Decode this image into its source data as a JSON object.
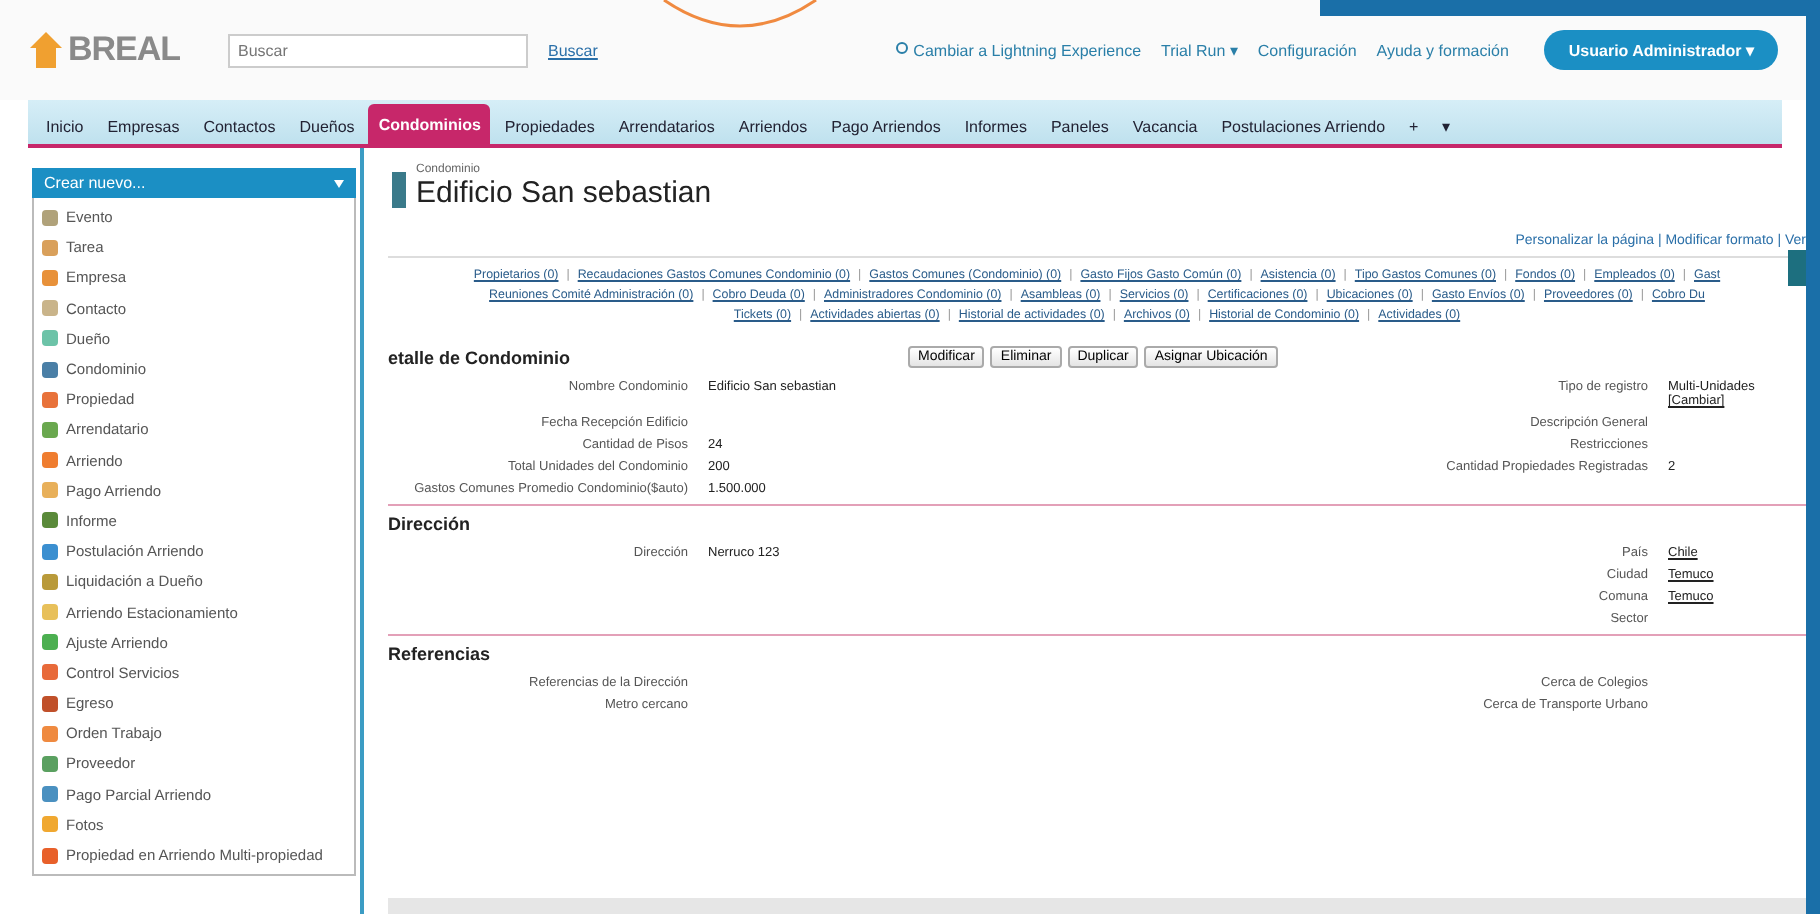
{
  "header": {
    "logo": "BREAL",
    "search": {
      "placeholder": "Buscar"
    },
    "search_button": "Buscar",
    "links": [
      {
        "label": "Cambiar a Lightning Experience",
        "kind": "lightning"
      },
      {
        "label": "Trial Run ▾",
        "kind": "plain"
      },
      {
        "label": "Configuración",
        "kind": "plain"
      },
      {
        "label": "Ayuda y formación",
        "kind": "plain"
      }
    ],
    "user_button": "Usuario Administrador ▾"
  },
  "tabs": [
    {
      "label": "Inicio",
      "selected": false
    },
    {
      "label": "Empresas",
      "selected": false
    },
    {
      "label": "Contactos",
      "selected": false
    },
    {
      "label": "Dueños",
      "selected": false
    },
    {
      "label": "Condominios",
      "selected": true
    },
    {
      "label": "Propiedades",
      "selected": false
    },
    {
      "label": "Arrendatarios",
      "selected": false
    },
    {
      "label": "Arriendos",
      "selected": false
    },
    {
      "label": "Pago Arriendos",
      "selected": false
    },
    {
      "label": "Informes",
      "selected": false
    },
    {
      "label": "Paneles",
      "selected": false
    },
    {
      "label": "Vacancia",
      "selected": false
    },
    {
      "label": "Postulaciones Arriendo",
      "selected": false
    },
    {
      "label": "+",
      "selected": false
    },
    {
      "label": "▾",
      "selected": false
    }
  ],
  "sidebar": {
    "create_button": "Crear nuevo...",
    "items": [
      {
        "label": "Evento",
        "color": "#b0a27a"
      },
      {
        "label": "Tarea",
        "color": "#d9a05b"
      },
      {
        "label": "Empresa",
        "color": "#e8913a"
      },
      {
        "label": "Contacto",
        "color": "#c9b48a"
      },
      {
        "label": "Dueño",
        "color": "#6cc3a8"
      },
      {
        "label": "Condominio",
        "color": "#4a7fa6"
      },
      {
        "label": "Propiedad",
        "color": "#e8723a"
      },
      {
        "label": "Arrendatario",
        "color": "#6aa84f"
      },
      {
        "label": "Arriendo",
        "color": "#ef7d30"
      },
      {
        "label": "Pago Arriendo",
        "color": "#e8b05a"
      },
      {
        "label": "Informe",
        "color": "#5a8a3a"
      },
      {
        "label": "Postulación Arriendo",
        "color": "#3b8fd0"
      },
      {
        "label": "Liquidación a Dueño",
        "color": "#b99a3a"
      },
      {
        "label": "Arriendo Estacionamiento",
        "color": "#e8c05a"
      },
      {
        "label": "Ajuste Arriendo",
        "color": "#4caf50"
      },
      {
        "label": "Control Servicios",
        "color": "#e86a3a"
      },
      {
        "label": "Egreso",
        "color": "#c0502a"
      },
      {
        "label": "Orden Trabajo",
        "color": "#ef8a40"
      },
      {
        "label": "Proveedor",
        "color": "#5aa060"
      },
      {
        "label": "Pago Parcial Arriendo",
        "color": "#4a90c0"
      },
      {
        "label": "Fotos",
        "color": "#f0a830"
      },
      {
        "label": "Propiedad en Arriendo Multi-propiedad",
        "color": "#e8602a"
      }
    ]
  },
  "record": {
    "type": "Condominio",
    "title": "Edificio San sebastian",
    "page_links": "Personalizar la página | Modificar formato | Ver",
    "related_separator": "|",
    "related_lists": [
      [
        "Propietarios (0)",
        "Recaudaciones Gastos Comunes Condominio (0)",
        "Gastos Comunes (Condominio) (0)",
        "Gasto Fijos Gasto Común (0)",
        "Asistencia (0)",
        "Tipo Gastos Comunes (0)",
        "Fondos (0)",
        "Empleados (0)",
        "Gast"
      ],
      [
        "Reuniones Comité Administración (0)",
        "Cobro Deuda (0)",
        "Administradores Condominio (0)",
        "Asambleas (0)",
        "Servicios (0)",
        "Certificaciones (0)",
        "Ubicaciones (0)",
        "Gasto Envíos (0)",
        "Proveedores (0)",
        "Cobro Du"
      ],
      [
        "Tickets (0)",
        "Actividades abiertas (0)",
        "Historial de actividades (0)",
        "Archivos (0)",
        "Historial de Condominio (0)",
        "Actividades (0)"
      ]
    ],
    "detail": {
      "title": "etalle de Condominio",
      "buttons": [
        "Modificar",
        "Eliminar",
        "Duplicar",
        "Asignar Ubicación"
      ],
      "rows": [
        {
          "left_label": "Nombre Condominio",
          "left_value": "Edificio San sebastian",
          "right_label": "Tipo de registro",
          "right_value": "Multi-Unidades",
          "right_link": "[Cambiar]"
        },
        {
          "left_label": "Fecha Recepción Edificio",
          "right_label": "Descripción General"
        },
        {
          "left_label": "Cantidad de Pisos",
          "left_value": "24",
          "right_label": "Restricciones"
        },
        {
          "left_label": "Total Unidades del Condominio",
          "left_value": "200",
          "right_label": "Cantidad Propiedades Registradas",
          "right_value": "2"
        },
        {
          "left_label": "Gastos Comunes Promedio Condominio($auto)",
          "left_value": "1.500.000"
        }
      ]
    },
    "sections": [
      {
        "title": "Dirección",
        "rows": [
          {
            "left_label": "Dirección",
            "left_value": "Nerruco 123",
            "right_label": "País",
            "right_link": "Chile"
          },
          {
            "right_label": "Ciudad",
            "right_link": "Temuco"
          },
          {
            "right_label": "Comuna",
            "right_link": "Temuco"
          },
          {
            "right_label": "Sector"
          }
        ]
      },
      {
        "title": "Referencias",
        "rows": [
          {
            "left_label": "Referencias de la Dirección",
            "right_label": "Cerca de Colegios"
          },
          {
            "left_label": "Metro cercano",
            "right_label": "Cerca de Transporte Urbano"
          }
        ]
      }
    ]
  }
}
